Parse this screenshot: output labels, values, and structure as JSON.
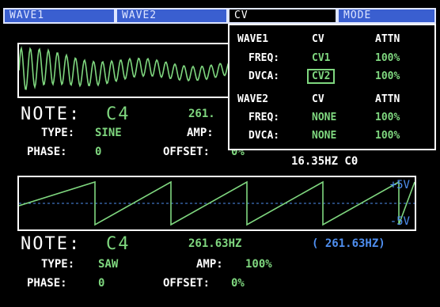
{
  "tabs": [
    "WAVE1",
    "WAVE2",
    "CV",
    "MODE"
  ],
  "colors": {
    "accent": "#7fd77f",
    "tab_bg": "#3a5fd0",
    "info_blue": "#4f8ff0"
  },
  "wave1": {
    "note_label": "NOTE:",
    "note": "C4",
    "freq": "261.",
    "type_label": "TYPE:",
    "type": "SINE",
    "amp_label": "AMP:",
    "phase_label": "PHASE:",
    "phase": "0",
    "offset_label": "OFFSET:",
    "offset": "0%"
  },
  "cv_ref": "16.35HZ C0",
  "wave2": {
    "note_label": "NOTE:",
    "note": "C4",
    "freq": "261.63HZ",
    "freq_alt": "( 261.63HZ)",
    "type_label": "TYPE:",
    "type": "SAW",
    "amp_label": "AMP:",
    "amp": "100%",
    "phase_label": "PHASE:",
    "phase": "0",
    "offset_label": "OFFSET:",
    "offset": "0%",
    "scale_top": "+5V",
    "scale_bottom": "-5V"
  },
  "cv": {
    "wave1": {
      "title": "WAVE1",
      "col_cv": "CV",
      "col_attn": "ATTN",
      "rows": [
        {
          "label": "FREQ:",
          "cv": "CV1",
          "attn": "100%"
        },
        {
          "label": "DVCA:",
          "cv": "CV2",
          "attn": "100%"
        }
      ]
    },
    "wave2": {
      "title": "WAVE2",
      "col_cv": "CV",
      "col_attn": "ATTN",
      "rows": [
        {
          "label": "FREQ:",
          "cv": "NONE",
          "attn": "100%"
        },
        {
          "label": "DVCA:",
          "cv": "NONE",
          "attn": "100%"
        }
      ]
    }
  }
}
